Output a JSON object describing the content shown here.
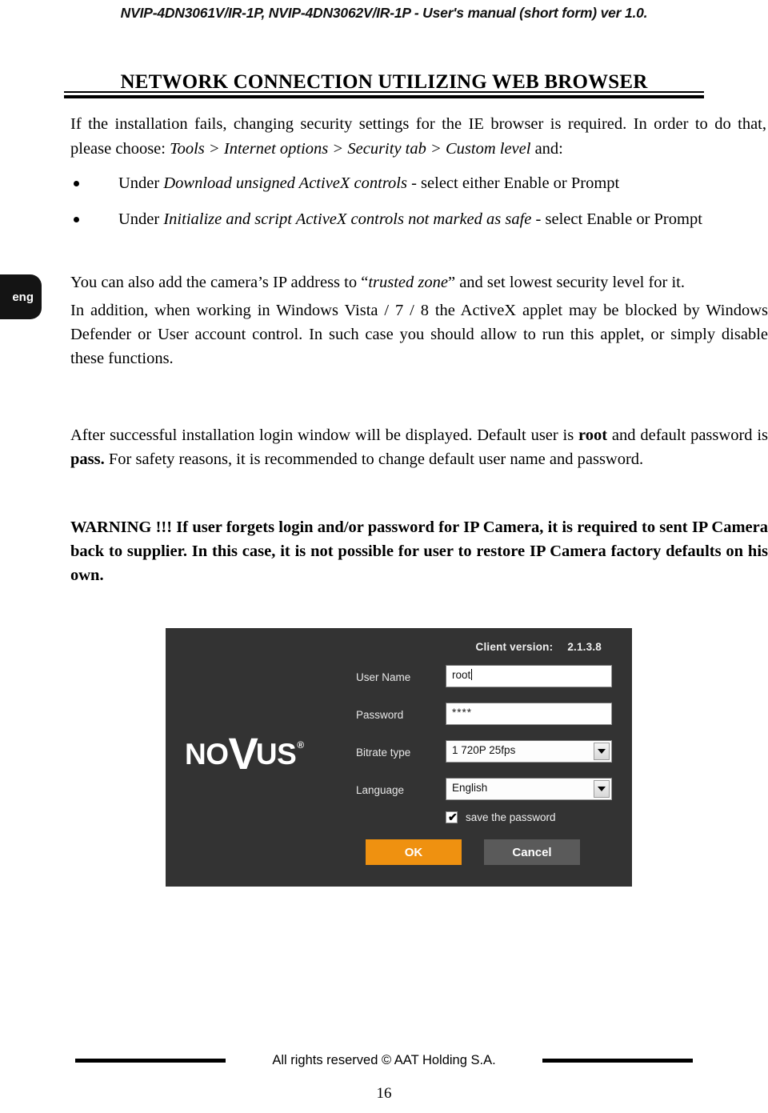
{
  "header": {
    "running_title": "NVIP-4DN3061V/IR-1P, NVIP-4DN3062V/IR-1P - User's manual (short form) ver 1.0."
  },
  "section": {
    "title": "NETWORK CONNECTION UTILIZING WEB BROWSER"
  },
  "intro": {
    "line_1": "If the installation fails, changing security settings for the IE browser is required. In order to do that, please choose: ",
    "path_1": "Tools",
    "sep_1": " > ",
    "path_2": "Internet options",
    "sep_2": " > ",
    "path_3": "Security tab",
    "sep_3": " > ",
    "path_4": "Custom level",
    "line_end": " and:"
  },
  "bullets": [
    {
      "prefix": "Under ",
      "emphasis": "Download unsigned ActiveX controls",
      "suffix": " - select either Enable or Prompt"
    },
    {
      "prefix": "Under ",
      "emphasis": "Initialize and script ActiveX controls not marked as safe",
      "suffix": " - select Enable or Prompt"
    }
  ],
  "language_tab": {
    "label": "eng"
  },
  "body": {
    "para_trusted_prefix": "You can also add the camera’s IP address to “",
    "para_trusted_emphasis": "trusted zone",
    "para_trusted_suffix": "” and set lowest security level for it.",
    "para_defender": "In addition, when working in Windows Vista / 7 / 8 the ActiveX applet may be blocked by Windows Defender or User account control. In such case you should allow to run this applet, or simply disable these functions.",
    "para_login_p1": "After successful installation login window will be displayed. Default user is ",
    "para_login_user": "root",
    "para_login_p2": " and default password is ",
    "para_login_pass": "pass.",
    "para_login_p3": " For safety reasons, it is recommended to change default user name and password.",
    "warning_label": "WARNING !!!",
    "warning_text": "  If user forgets login and/or password for IP Camera, it is required to sent IP Camera back to supplier. In this case, it is not possible for user to restore IP Camera factory defaults on his own."
  },
  "login_dialog": {
    "version_label": "Client version:",
    "version_value": "2.1.3.8",
    "logo": {
      "part_1": "NO",
      "part_2": "V",
      "part_3": "US",
      "registered": "®"
    },
    "fields": [
      {
        "label": "User Name",
        "value": "root",
        "type": "text"
      },
      {
        "label": "Password",
        "value": "****",
        "type": "password"
      },
      {
        "label": "Bitrate type",
        "value": "1 720P 25fps",
        "type": "select"
      },
      {
        "label": "Language",
        "value": "English",
        "type": "select"
      }
    ],
    "checkbox": {
      "label": "save the password",
      "checked_glyph": "✔"
    },
    "buttons": {
      "ok": "OK",
      "cancel": "Cancel"
    },
    "colors": {
      "panel": "#333333",
      "ok_button": "#ef9110",
      "cancel_button": "#5a5a5a"
    }
  },
  "footer": {
    "copyright": "All rights reserved © AAT Holding S.A.",
    "page_number": "16"
  }
}
